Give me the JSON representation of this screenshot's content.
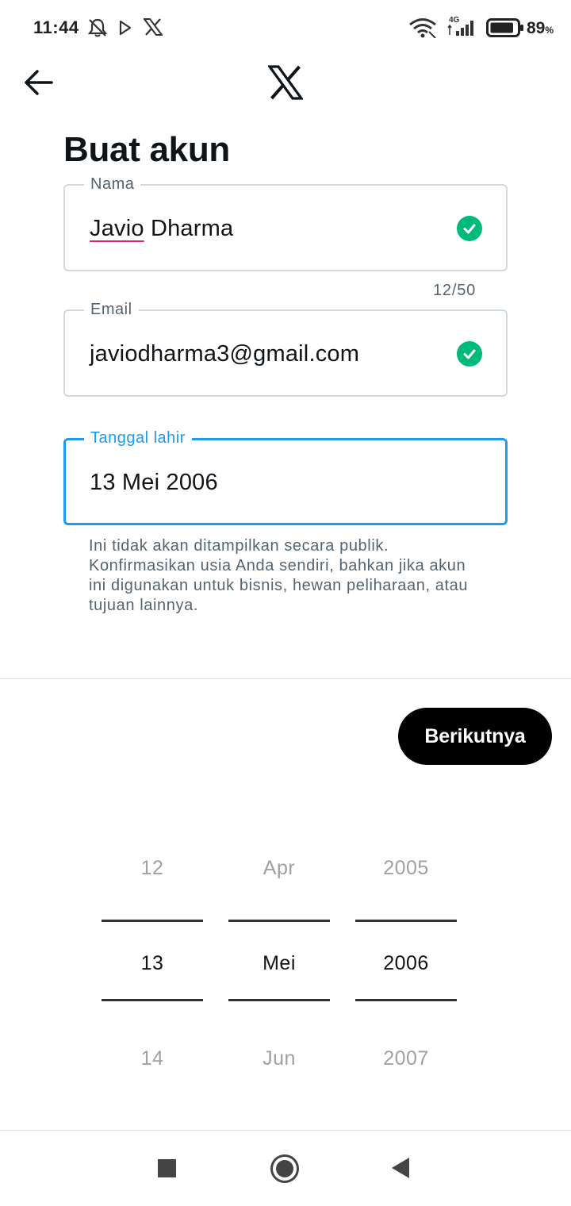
{
  "status_bar": {
    "time": "11:44",
    "network": "4G",
    "battery_percent": "89",
    "battery_unit": "%",
    "battery_level": 0.89
  },
  "header": {
    "back_icon": "arrow-left-icon",
    "logo": "x-logo"
  },
  "page": {
    "title": "Buat akun"
  },
  "form": {
    "name": {
      "label": "Nama",
      "value_misspelled": "Javio",
      "value_rest": " Dharma",
      "char_count": "12/50",
      "valid_icon": "check-circle-icon"
    },
    "email": {
      "label": "Email",
      "value": "javiodharma3@gmail.com",
      "valid_icon": "check-circle-icon"
    },
    "birthdate": {
      "label": "Tanggal lahir",
      "value": "13 Mei 2006",
      "helper_text": "Ini tidak akan ditampilkan secara publik. Konfirmasikan usia Anda sendiri, bahkan jika akun ini digunakan untuk bisnis, hewan peliharaan, atau tujuan lainnya."
    }
  },
  "actions": {
    "next_label": "Berikutnya"
  },
  "date_picker": {
    "day": {
      "prev": "12",
      "selected": "13",
      "next": "14"
    },
    "month": {
      "prev": "Apr",
      "selected": "Mei",
      "next": "Jun"
    },
    "year": {
      "prev": "2005",
      "selected": "2006",
      "next": "2007"
    }
  },
  "colors": {
    "accent": "#1d9bf0",
    "success": "#00ba7c",
    "text_primary": "#0f1419",
    "text_secondary": "#536471",
    "button_bg": "#000000"
  }
}
